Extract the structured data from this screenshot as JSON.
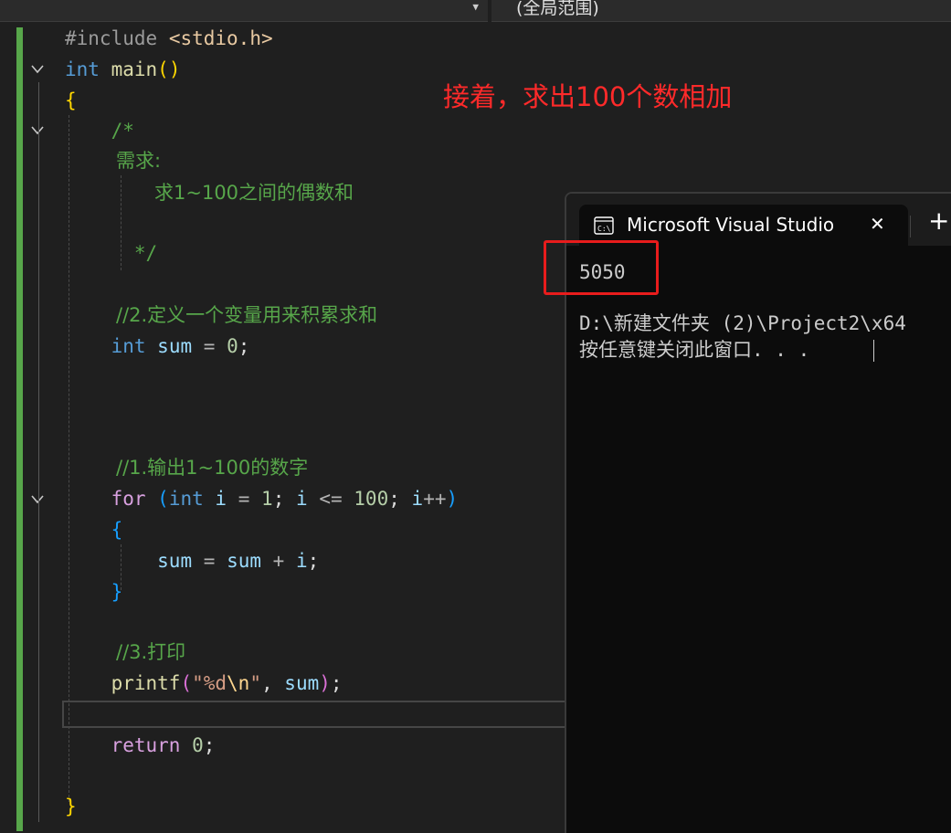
{
  "toolbar": {
    "scope_dropdown": "(全局范围)"
  },
  "annotation": {
    "text": "接着，求出100个数相加",
    "color": "#ff2a2a"
  },
  "code": {
    "include_directive": "#include",
    "include_file": "<stdio.h>",
    "kw_int": "int",
    "fn_main": "main",
    "open_paren": "(",
    "close_paren": ")",
    "brace_open": "{",
    "brace_close": "}",
    "comment_start": "/*",
    "comment_req": "需求:",
    "comment_task": "求1~100之间的偶数和",
    "comment_end": "*/",
    "comment_step2": "//2.定义一个变量用来积累求和",
    "var_sum": "sum",
    "op_assign": "=",
    "num_0": "0",
    "semicolon": ";",
    "comment_step1": "//1.输出1~100的数字",
    "kw_for": "for",
    "var_i": "i",
    "num_1": "1",
    "op_le": "<=",
    "num_100": "100",
    "op_inc": "++",
    "op_plus": "+",
    "comment_step3": "//3.打印",
    "fn_printf": "printf",
    "str_fmt_open": "\"%d",
    "str_escape": "\\n",
    "str_fmt_close": "\"",
    "comma": ",",
    "kw_return": "return"
  },
  "console": {
    "title": "Microsoft Visual Studio",
    "close_glyph": "✕",
    "new_tab_glyph": "+",
    "output_value": "5050",
    "path_line": "D:\\新建文件夹 (2)\\Project2\\x64",
    "prompt_line": "按任意键关闭此窗口. . ."
  },
  "colors": {
    "change_bar": "#57a64a",
    "console_bg": "#0c0c0c",
    "editor_bg": "#1f1f1f",
    "highlight_box": "#e81c1c"
  }
}
